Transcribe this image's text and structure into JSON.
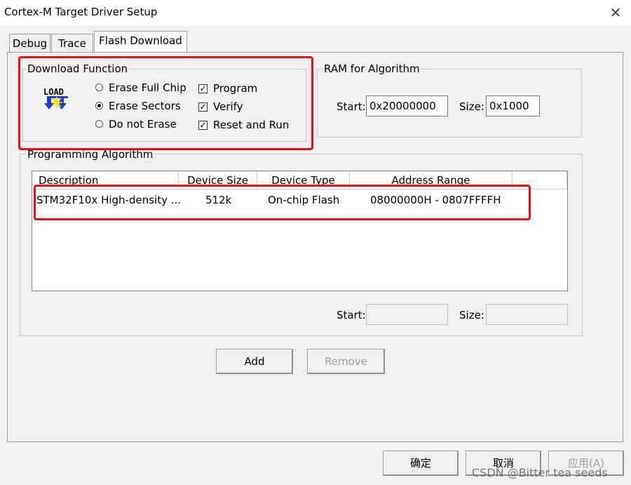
{
  "window": {
    "title": "Cortex-M Target Driver Setup",
    "close_icon": "close-icon"
  },
  "tabs": [
    {
      "label": "Debug",
      "active": false
    },
    {
      "label": "Trace",
      "active": false
    },
    {
      "label": "Flash Download",
      "active": true
    }
  ],
  "download_function": {
    "title": "Download Function",
    "icon": "load-icon",
    "icon_text": "LOAD",
    "radios": [
      {
        "label": "Erase Full Chip",
        "selected": false
      },
      {
        "label": "Erase Sectors",
        "selected": true
      },
      {
        "label": "Do not Erase",
        "selected": false
      }
    ],
    "checks": [
      {
        "label": "Program",
        "checked": true
      },
      {
        "label": "Verify",
        "checked": true
      },
      {
        "label": "Reset and Run",
        "checked": true
      }
    ]
  },
  "ram": {
    "title": "RAM for Algorithm",
    "start_label": "Start:",
    "start_value": "0x20000000",
    "size_label": "Size:",
    "size_value": "0x1000"
  },
  "algorithm": {
    "title": "Programming Algorithm",
    "columns": [
      "Description",
      "Device Size",
      "Device Type",
      "Address Range"
    ],
    "rows": [
      {
        "description": "STM32F10x High-density ...",
        "size": "512k",
        "type": "On-chip Flash",
        "range": "08000000H - 0807FFFFH"
      }
    ],
    "start_label": "Start:",
    "start_value": "",
    "size_label": "Size:",
    "size_value": ""
  },
  "buttons": {
    "add": "Add",
    "remove": "Remove",
    "ok": "确定",
    "cancel": "取消",
    "apply": "应用(A)"
  },
  "watermark": "CSDN @Bitter tea seeds",
  "colors": {
    "highlight": "#ee1111"
  }
}
